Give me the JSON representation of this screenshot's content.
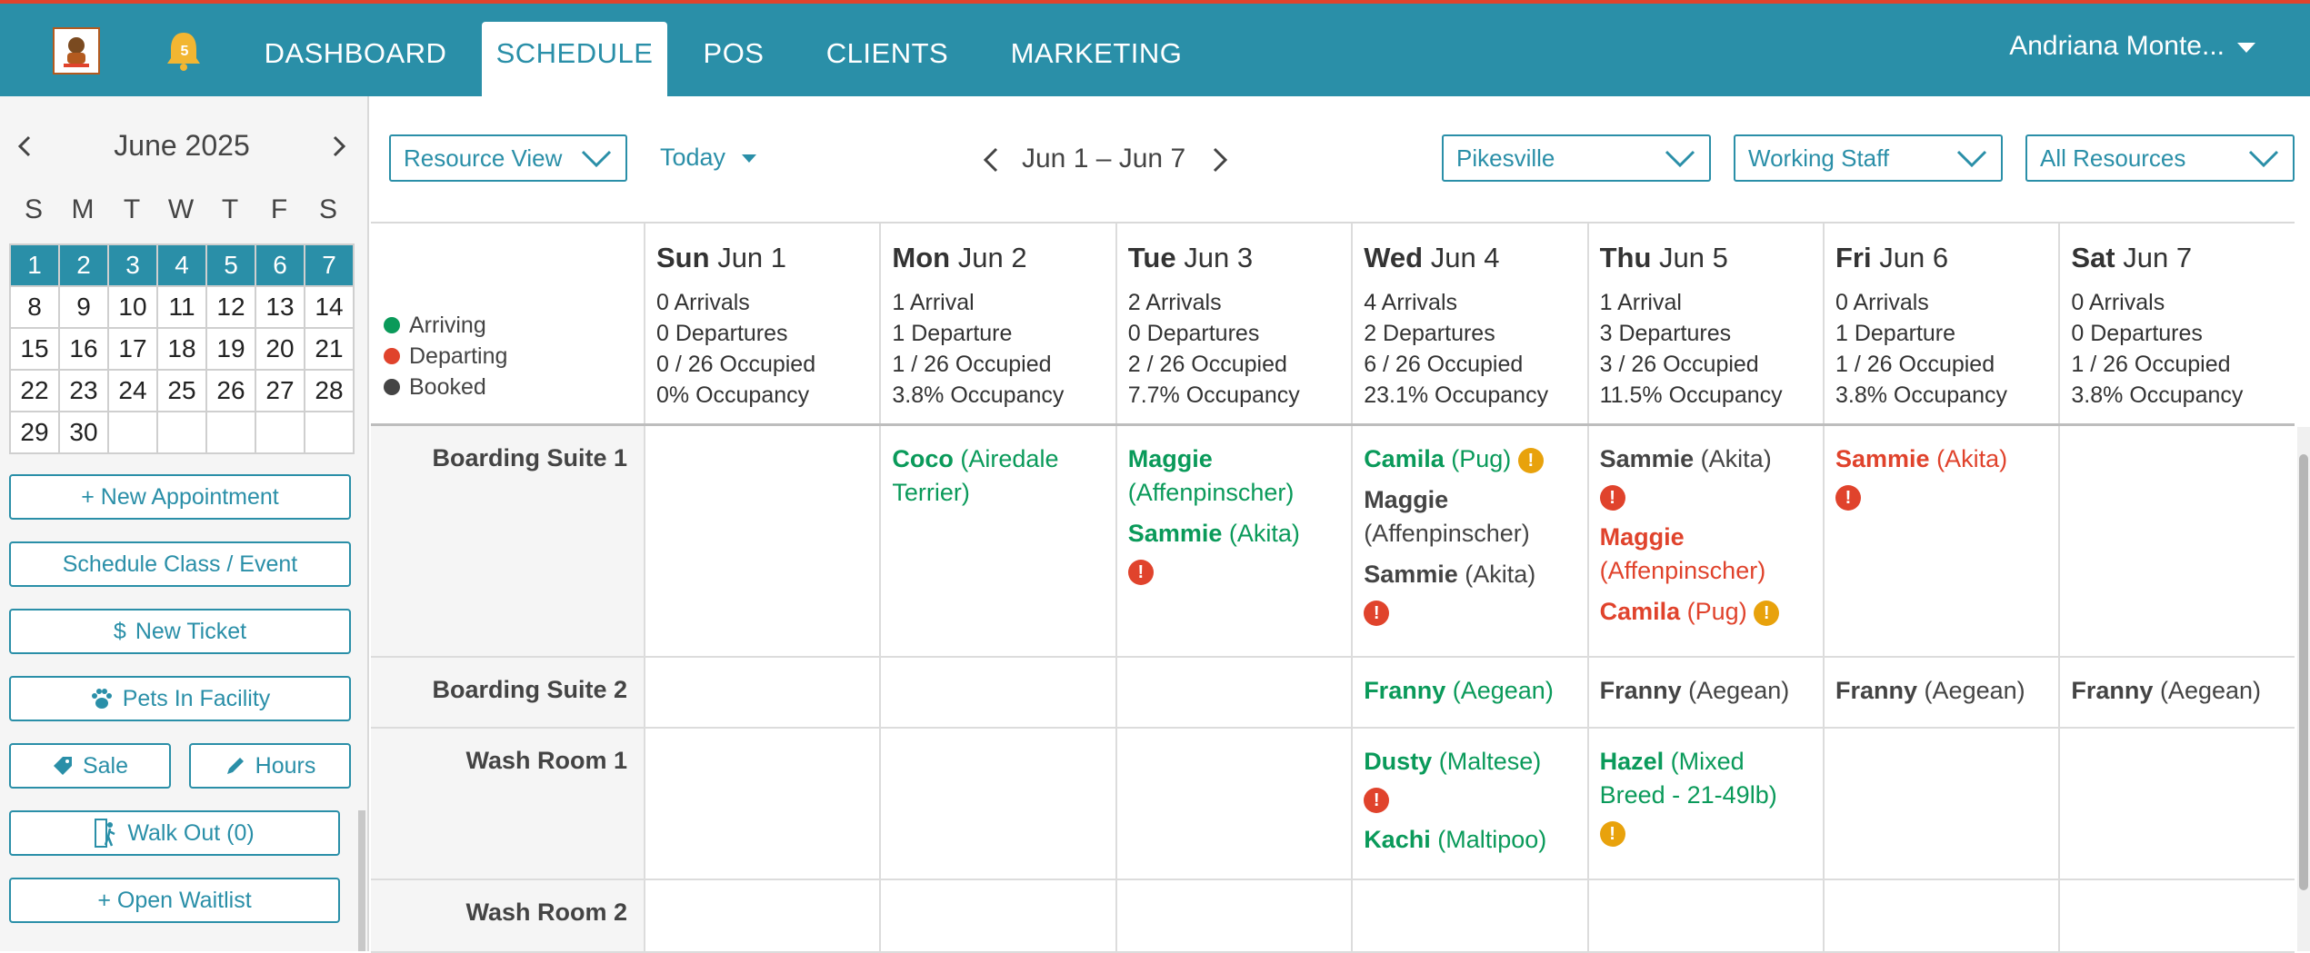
{
  "nav": {
    "notification_count": "5",
    "items": [
      "DASHBOARD",
      "SCHEDULE",
      "POS",
      "CLIENTS",
      "MARKETING"
    ],
    "active": "SCHEDULE",
    "user": "Andriana Monte..."
  },
  "calendar": {
    "month_label": "June 2025",
    "weekdays": [
      "S",
      "M",
      "T",
      "W",
      "T",
      "F",
      "S"
    ],
    "weeks": [
      [
        "1",
        "2",
        "3",
        "4",
        "5",
        "6",
        "7"
      ],
      [
        "8",
        "9",
        "10",
        "11",
        "12",
        "13",
        "14"
      ],
      [
        "15",
        "16",
        "17",
        "18",
        "19",
        "20",
        "21"
      ],
      [
        "22",
        "23",
        "24",
        "25",
        "26",
        "27",
        "28"
      ],
      [
        "29",
        "30",
        "",
        "",
        "",
        "",
        ""
      ]
    ],
    "selected_week": 0
  },
  "sidebar": {
    "new_appointment": "+ New Appointment",
    "schedule_class": "Schedule Class / Event",
    "new_ticket": "New Ticket",
    "pets_in_facility": "Pets In Facility",
    "sale": "Sale",
    "hours": "Hours",
    "walk_out": "Walk Out (0)",
    "open_waitlist": "+ Open Waitlist"
  },
  "toolbar": {
    "view": "Resource View",
    "today": "Today",
    "range": "Jun 1 – Jun 7",
    "location": "Pikesville",
    "staff": "Working Staff",
    "resources": "All Resources"
  },
  "legend": {
    "arriving": "Arriving",
    "departing": "Departing",
    "booked": "Booked"
  },
  "colors": {
    "arriving": "#0a9a5a",
    "departing": "#e0432c",
    "booked": "#444444",
    "brand": "#2a8fa8"
  },
  "days": [
    {
      "dow": "Sun",
      "date": "Jun 1",
      "arrivals": "0 Arrivals",
      "departures": "0 Departures",
      "occupied": "0 / 26 Occupied",
      "occupancy": "0% Occupancy"
    },
    {
      "dow": "Mon",
      "date": "Jun 2",
      "arrivals": "1 Arrival",
      "departures": "1 Departure",
      "occupied": "1 / 26 Occupied",
      "occupancy": "3.8% Occupancy"
    },
    {
      "dow": "Tue",
      "date": "Jun 3",
      "arrivals": "2 Arrivals",
      "departures": "0 Departures",
      "occupied": "2 / 26 Occupied",
      "occupancy": "7.7% Occupancy"
    },
    {
      "dow": "Wed",
      "date": "Jun 4",
      "arrivals": "4 Arrivals",
      "departures": "2 Departures",
      "occupied": "6 / 26 Occupied",
      "occupancy": "23.1% Occupancy"
    },
    {
      "dow": "Thu",
      "date": "Jun 5",
      "arrivals": "1 Arrival",
      "departures": "3 Departures",
      "occupied": "3 / 26 Occupied",
      "occupancy": "11.5% Occupancy"
    },
    {
      "dow": "Fri",
      "date": "Jun 6",
      "arrivals": "0 Arrivals",
      "departures": "1 Departure",
      "occupied": "1 / 26 Occupied",
      "occupancy": "3.8% Occupancy"
    },
    {
      "dow": "Sat",
      "date": "Jun 7",
      "arrivals": "0 Arrivals",
      "departures": "0 Departures",
      "occupied": "1 / 26 Occupied",
      "occupancy": "3.8% Occupancy"
    }
  ],
  "resources": [
    {
      "name": "Boarding Suite 1",
      "cells": [
        [],
        [
          {
            "name": "Coco",
            "breed": "(Airedale Terrier)",
            "status": "arriving"
          }
        ],
        [
          {
            "name": "Maggie",
            "breed": "(Affenpinscher)",
            "status": "arriving"
          },
          {
            "name": "Sammie",
            "breed": "(Akita)",
            "status": "arriving",
            "alert": "red",
            "alert_newline": true
          }
        ],
        [
          {
            "name": "Camila",
            "breed": "(Pug)",
            "status": "arriving",
            "alert": "yellow"
          },
          {
            "name": "Maggie",
            "breed": "(Affenpinscher)",
            "status": "booked"
          },
          {
            "name": "Sammie",
            "breed": "(Akita)",
            "status": "booked",
            "alert": "red",
            "alert_newline": true
          }
        ],
        [
          {
            "name": "Sammie",
            "breed": "(Akita)",
            "status": "booked",
            "alert": "red",
            "alert_newline": true
          },
          {
            "name": "Maggie",
            "breed": "(Affenpinscher)",
            "status": "departing"
          },
          {
            "name": "Camila",
            "breed": "(Pug)",
            "status": "departing",
            "alert": "yellow"
          }
        ],
        [
          {
            "name": "Sammie",
            "breed": "(Akita)",
            "status": "departing",
            "alert": "red",
            "alert_newline": true
          }
        ],
        []
      ]
    },
    {
      "name": "Boarding Suite 2",
      "cells": [
        [],
        [],
        [],
        [
          {
            "name": "Franny",
            "breed": "(Aegean)",
            "status": "arriving"
          }
        ],
        [
          {
            "name": "Franny",
            "breed": "(Aegean)",
            "status": "booked"
          }
        ],
        [
          {
            "name": "Franny",
            "breed": "(Aegean)",
            "status": "booked"
          }
        ],
        [
          {
            "name": "Franny",
            "breed": "(Aegean)",
            "status": "booked"
          }
        ]
      ]
    },
    {
      "name": "Wash Room 1",
      "cells": [
        [],
        [],
        [],
        [
          {
            "name": "Dusty",
            "breed": "(Maltese)",
            "status": "arriving",
            "alert": "red",
            "alert_newline": true
          },
          {
            "name": "Kachi",
            "breed": "(Maltipoo)",
            "status": "arriving"
          }
        ],
        [
          {
            "name": "Hazel",
            "breed": "(Mixed Breed - 21-49lb)",
            "status": "arriving",
            "alert": "yellow",
            "alert_newline": true
          }
        ],
        [],
        []
      ]
    },
    {
      "name": "Wash Room 2",
      "cells": [
        [],
        [],
        [],
        [],
        [],
        [],
        []
      ]
    }
  ]
}
